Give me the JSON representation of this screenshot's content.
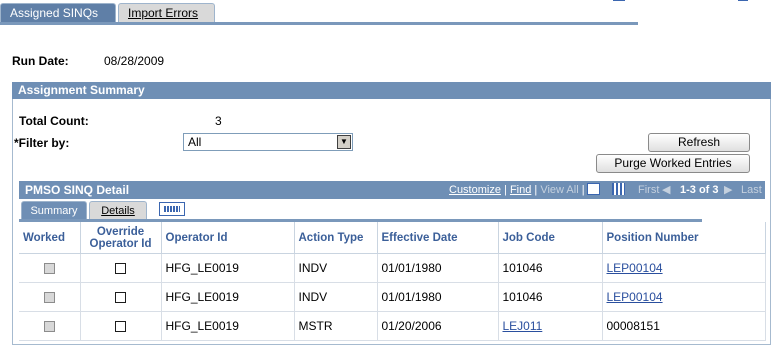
{
  "tabs": {
    "active": "Assigned SINQs",
    "inactive": "Import Errors"
  },
  "run_date": {
    "label": "Run Date:",
    "value": "08/28/2009"
  },
  "summary": {
    "title": "Assignment Summary",
    "total_label": "Total Count:",
    "total_value": "3",
    "filter_label": "*Filter by:",
    "filter_value": "All",
    "refresh_label": "Refresh",
    "purge_label": "Purge Worked Entries"
  },
  "grid": {
    "title": "PMSO SINQ Detail",
    "customize": "Customize",
    "find": "Find",
    "view_all": "View All",
    "first": "First",
    "range": "1-3 of 3",
    "last": "Last",
    "subtabs": [
      "Summary",
      "Details"
    ],
    "columns": [
      "Worked",
      "Override Operator Id",
      "Operator Id",
      "Action Type",
      "Effective Date",
      "Job Code",
      "Position Number"
    ],
    "rows": [
      {
        "operator": "HFG_LE0019",
        "action": "INDV",
        "effdt": "01/01/1980",
        "jobcode": "101046",
        "position": "LEP00104"
      },
      {
        "operator": "HFG_LE0019",
        "action": "INDV",
        "effdt": "01/01/1980",
        "jobcode": "101046",
        "position": "LEP00104"
      },
      {
        "operator": "HFG_LE0019",
        "action": "MSTR",
        "effdt": "01/20/2006",
        "jobcode": "LEJ011",
        "position": "00008151"
      }
    ]
  },
  "colors": {
    "header_blue": "#6f8fb5",
    "active_tab": "#5f7fa7",
    "link": "#2a4f9e",
    "column_header": "#3b5f99"
  }
}
